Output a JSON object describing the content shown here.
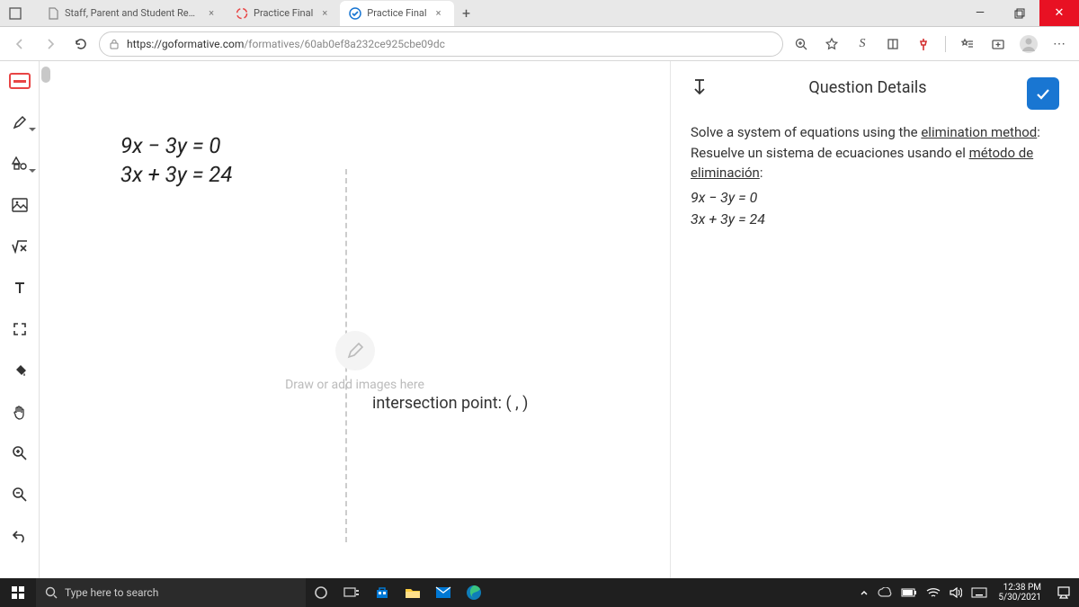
{
  "browser": {
    "tabs": [
      {
        "title": "Staff, Parent and Student Resour"
      },
      {
        "title": "Practice Final"
      },
      {
        "title": "Practice Final"
      }
    ],
    "url_domain": "https://goformative.com",
    "url_path": "/formatives/60ab0ef8a232ce925cbe09dc"
  },
  "toolbar": {
    "items": [
      "eraser",
      "pen",
      "shapes",
      "image",
      "math",
      "text",
      "fullscreen",
      "fill",
      "hand",
      "zoom-in",
      "zoom-out",
      "undo"
    ]
  },
  "canvas": {
    "eq1": "9x − 3y = 0",
    "eq2": "3x + 3y = 24",
    "hint": "Draw or add images here",
    "intersection_label": "intersection point: (    ,    )"
  },
  "panel": {
    "title": "Question Details",
    "prompt_en_a": "Solve a system of equations using the ",
    "prompt_en_b": "elimination method",
    "colon": ":",
    "prompt_es_a": "Resuelve un sistema de ecuaciones usando el ",
    "prompt_es_b": "método de eliminación",
    "eq1": "9x − 3y = 0",
    "eq2": "3x + 3y = 24"
  },
  "taskbar": {
    "search_placeholder": "Type here to search",
    "time": "12:38 PM",
    "date": "5/30/2021"
  }
}
